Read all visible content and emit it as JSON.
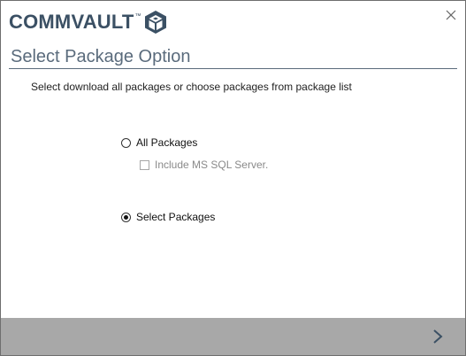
{
  "header": {
    "logo_text": "COMMVAULT",
    "logo_tm": "™"
  },
  "page": {
    "title": "Select Package Option",
    "instructions": "Select download all packages or choose packages from package list"
  },
  "options": {
    "all_packages": {
      "label": "All Packages",
      "selected": false
    },
    "include_sql": {
      "label": "Include MS SQL Server.",
      "checked": false,
      "enabled": false
    },
    "select_packages": {
      "label": "Select Packages",
      "selected": true
    }
  },
  "footer": {
    "next_icon": "chevron-right-icon"
  },
  "colors": {
    "brand": "#3b5064",
    "title": "#5a6b7c",
    "footer": "#a8a8a8",
    "next_arrow": "#3b5064"
  }
}
